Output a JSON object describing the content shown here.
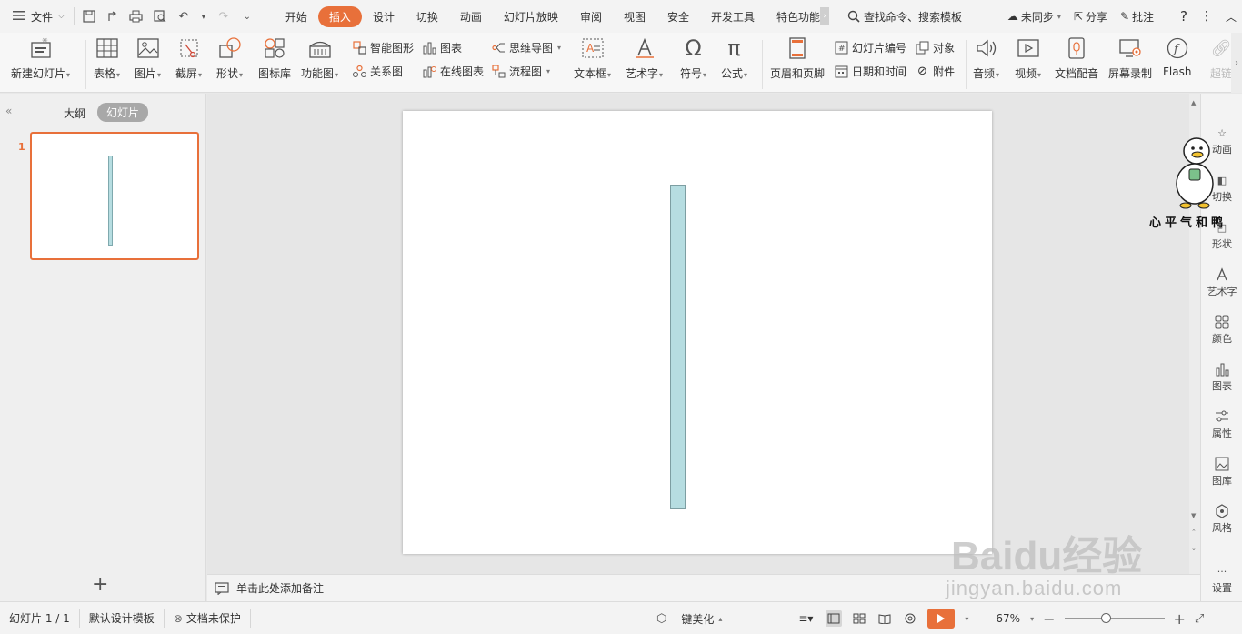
{
  "menubar": {
    "file_label": "文件",
    "tabs": [
      "开始",
      "插入",
      "设计",
      "切换",
      "动画",
      "幻灯片放映",
      "审阅",
      "视图",
      "安全",
      "开发工具",
      "特色功能"
    ],
    "active_tab": "插入",
    "search_label": "查找命令、搜索模板",
    "sync_label": "未同步",
    "share_label": "分享",
    "review_label": "批注"
  },
  "ribbon": {
    "new_slide": "新建幻灯片",
    "table": "表格",
    "picture": "图片",
    "screenshot": "截屏",
    "shape": "形状",
    "icon_lib": "图标库",
    "func_chart": "功能图",
    "smart_art": "智能图形",
    "chart": "图表",
    "relation": "关系图",
    "online_chart": "在线图表",
    "mindmap": "思维导图",
    "flowchart": "流程图",
    "textbox": "文本框",
    "wordart": "艺术字",
    "symbol": "符号",
    "formula": "公式",
    "header_footer": "页眉和页脚",
    "slide_number": "幻灯片编号",
    "object": "对象",
    "datetime": "日期和时间",
    "attachment": "附件",
    "audio": "音频",
    "video": "视频",
    "doc_audio": "文档配音",
    "screen_record": "屏幕录制",
    "flash": "Flash",
    "hyperlink": "超链"
  },
  "leftpanel": {
    "outline_tab": "大纲",
    "slides_tab": "幻灯片",
    "slide_number": "1"
  },
  "notes": {
    "placeholder": "单击此处添加备注"
  },
  "rightpanel": {
    "items": [
      "动画",
      "切换",
      "形状",
      "艺术字",
      "颜色",
      "图表",
      "属性",
      "图库",
      "风格",
      "设置"
    ]
  },
  "statusbar": {
    "slide_count": "幻灯片 1 / 1",
    "template": "默认设计模板",
    "protection": "文档未保护",
    "beautify": "一键美化",
    "zoom": "67%",
    "zoom_fraction": 0.42
  },
  "watermarks": {
    "duck_sign": "心平气和鸭",
    "baidu": "Baidu经验",
    "baidu_url": "jingyan.baidu.com"
  },
  "colors": {
    "accent": "#e8703a",
    "shape_fill": "#b6dde1",
    "shape_border": "#7d9ea2"
  }
}
